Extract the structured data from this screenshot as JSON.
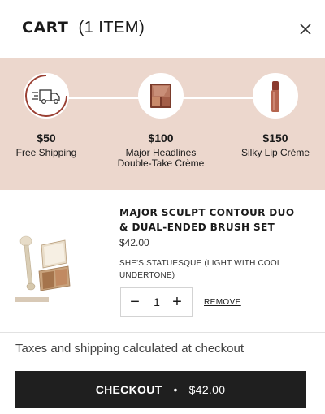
{
  "header": {
    "title": "CART",
    "item_count": "(1 ITEM)"
  },
  "rewards": {
    "progress_percent": 100,
    "tiers": [
      {
        "amount": "$50",
        "label": "Free Shipping",
        "icon": "delivery-truck-icon"
      },
      {
        "amount": "$100",
        "label": "Major Headlines Double-Take Crème",
        "icon": "eyeshadow-palette-icon"
      },
      {
        "amount": "$150",
        "label": "Silky Lip Crème",
        "icon": "lip-creme-tube-icon"
      }
    ]
  },
  "cart_item": {
    "name": "MAJOR SCULPT CONTOUR DUO & DUAL-ENDED BRUSH SET",
    "price": "$42.00",
    "variant": "SHE'S STATUESQUE (LIGHT WITH COOL UNDERTONE)",
    "quantity": "1",
    "minus_label": "−",
    "plus_label": "+",
    "remove_label": "REMOVE"
  },
  "footer": {
    "note": "Taxes and shipping calculated at checkout",
    "checkout_label": "CHECKOUT",
    "separator": "•",
    "total": "$42.00"
  },
  "colors": {
    "rewards_bg": "#ecd7cd",
    "progress": "#9a3f32",
    "checkout_bg": "#1f1f1f"
  }
}
